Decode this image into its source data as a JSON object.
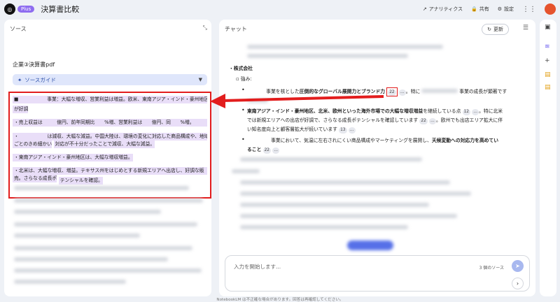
{
  "header": {
    "logo_glyph": "◎",
    "plan_badge": "Plus",
    "title": "決算書比較",
    "analytics": "アナリティクス",
    "share": "共有",
    "settings": "設定"
  },
  "sources": {
    "title": "ソース",
    "document": "企業③決算書pdf",
    "guide": "ソースガイド",
    "highlight_lines": [
      "■　　　　　　事業：大幅な増収、営業利益は増益。欧米、東南アジア・インド・豪州地区",
      "が好調",
      "・売上収益は　　　億円、前年同期比　　%増、営業利益は　　億円、同　　%増。",
      "・　　　　　　は減収、大幅な減益。中国大陸は、環境の変化に対応した商品構成や、地域",
      "ごとのきめ細かい",
      "対応が不十分だったことで減収、大幅な減益。",
      "・東南アジア・インド・豪州地区は、大幅な増収増益。",
      "・北米は、大幅な増収、増益。テキサス州をはじめとする新規エリアへ出店し、好調な販",
      "売。さらなる成長ポ",
      "テンシャルを確認。"
    ]
  },
  "chat": {
    "title": "チャット",
    "refresh": "更新",
    "company": "・株式会社",
    "strengths": "強み:",
    "line1_a": "　　　　事業を核とした",
    "line1_bold": "圧倒的なグローバル展開力とブランド力",
    "line1_cite": "22",
    "line1_b": "。特に",
    "line1_c": "事業の成長が顕著です",
    "line2_bold": "東南アジア・インド・豪州地区、北米、欧州といった海外市場での大幅な増収増益",
    "line2_a": "を継続している点",
    "line2_cite": "12",
    "line2_b": "。特に北米",
    "line3": "では新規エリアへの出店が好調で、さらなる成長ポテンシャルを確認しています",
    "line3_cite": "22",
    "line3_b": "。欧州でも出店エリア拡大に伴",
    "line4": "い知名度向上と顧客層拡大が続いています",
    "line4_cite": "13",
    "line5_a": "　　　　　事業において、気温に左右されにくい商品構成やマーケティングを展開し、",
    "line5_bold": "天候変動への対応力を高めてい",
    "line6_bold": "ること",
    "line6_cite": "22",
    "input_placeholder": "入力を開始します...",
    "source_count": "3 個のソース"
  },
  "footer": "NotebookLM は不正確な場合があります。回答は再確認してください。",
  "colors": {
    "highlight_border": "#e21d1d",
    "accent": "#8e6cf0"
  }
}
